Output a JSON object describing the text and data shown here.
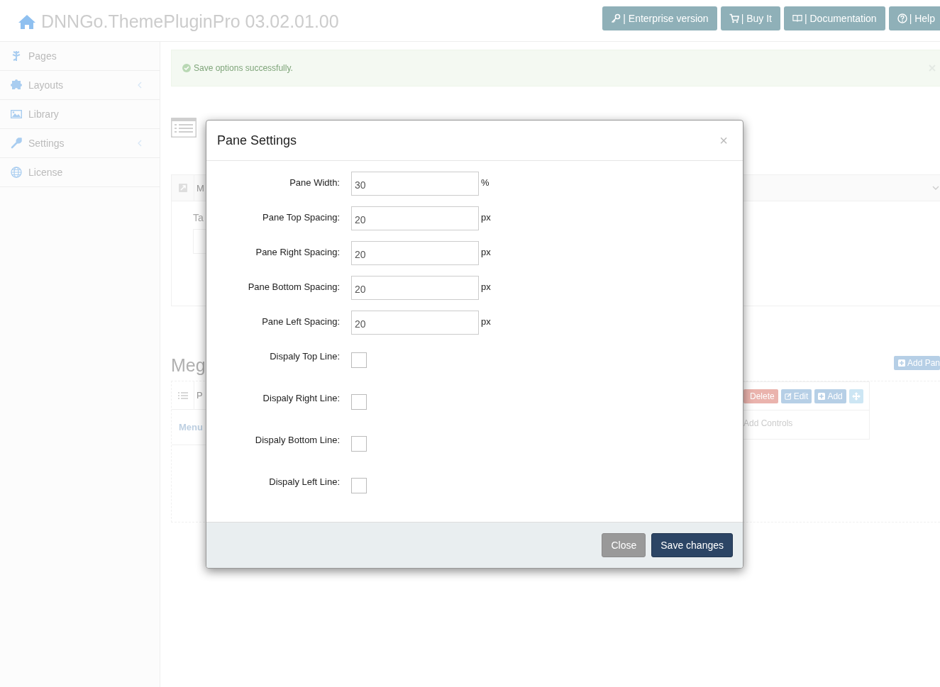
{
  "app": {
    "title": "DNNGo.ThemePluginPro 03.02.01.00"
  },
  "header_buttons": [
    {
      "kind": "key",
      "label": "| Enterprise version"
    },
    {
      "kind": "cart",
      "label": "| Buy It"
    },
    {
      "kind": "book",
      "label": "| Documentation"
    },
    {
      "kind": "help",
      "label": "| Help"
    }
  ],
  "sidebar": {
    "items": [
      {
        "kind": "pages",
        "label": "Pages",
        "has_submenu": false
      },
      {
        "kind": "layouts",
        "label": "Layouts",
        "has_submenu": true
      },
      {
        "kind": "library",
        "label": "Library",
        "has_submenu": false
      },
      {
        "kind": "settings",
        "label": "Settings",
        "has_submenu": true
      },
      {
        "kind": "license",
        "label": "License",
        "has_submenu": false
      }
    ]
  },
  "alert": {
    "text": "Save options successfully."
  },
  "panel_1": {
    "header": "M",
    "field_label": "Ta"
  },
  "section_2": {
    "heading": "Meg",
    "add_button": "Add Pan",
    "header": "P",
    "link": "Menu",
    "card_buttons": [
      {
        "kind": "delete",
        "label": "Delete"
      },
      {
        "kind": "edit",
        "label": "Edit"
      },
      {
        "kind": "add",
        "label": "Add"
      },
      {
        "kind": "move"
      }
    ],
    "card_text": "Add Controls"
  },
  "modal": {
    "title": "Pane Settings",
    "close": "×",
    "fields": [
      {
        "kind": "input",
        "label": "Pane Width:",
        "value": "30",
        "unit": "%"
      },
      {
        "kind": "input",
        "label": "Pane Top Spacing:",
        "value": "20",
        "unit": "px"
      },
      {
        "kind": "input",
        "label": "Pane Right Spacing:",
        "value": "20",
        "unit": "px"
      },
      {
        "kind": "input",
        "label": "Pane Bottom Spacing:",
        "value": "20",
        "unit": "px"
      },
      {
        "kind": "input",
        "label": "Pane Left Spacing:",
        "value": "20",
        "unit": "px"
      },
      {
        "kind": "checkbox",
        "label": "Dispaly Top Line:",
        "checked": false
      },
      {
        "kind": "checkbox",
        "label": "Dispaly Right Line:",
        "checked": false
      },
      {
        "kind": "checkbox",
        "label": "Dispaly Bottom Line:",
        "checked": false
      },
      {
        "kind": "checkbox",
        "label": "Dispaly Left Line:",
        "checked": false
      }
    ],
    "buttons": [
      {
        "kind": "secondary",
        "label": "Close"
      },
      {
        "kind": "primary",
        "label": "Save changes"
      }
    ]
  }
}
